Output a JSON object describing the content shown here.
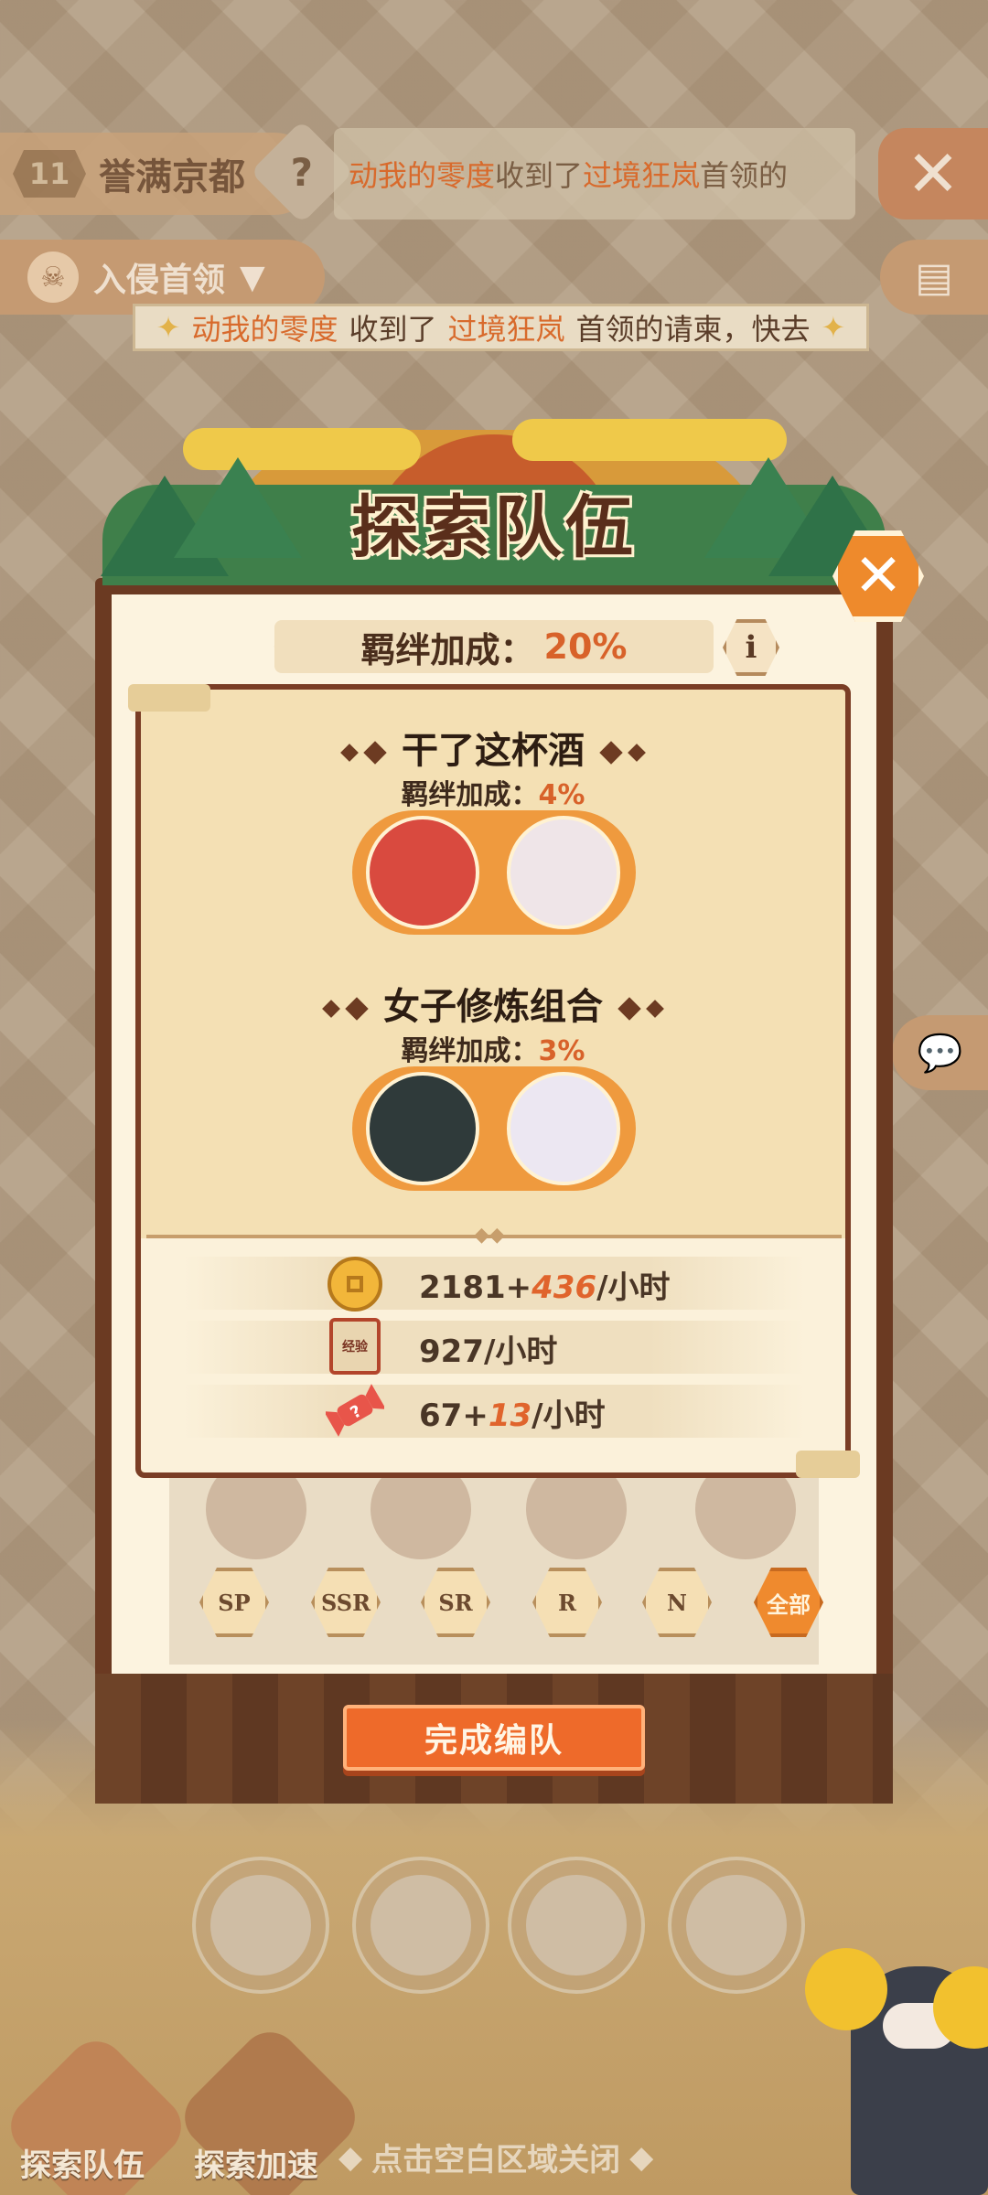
{
  "hud": {
    "level": "11",
    "region": "誉满京都",
    "help": "?",
    "ticker_a": "动我的零度",
    "ticker_b": "收到了",
    "ticker_c": "过境狂岚",
    "ticker_d": "首领的",
    "close": "✕",
    "boss_label": "入侵首领",
    "banner_a": "动我的零度",
    "banner_b": "收到了",
    "banner_c": "过境狂岚",
    "banner_d": "首领的请柬，快去"
  },
  "dialog": {
    "title": "探索队伍",
    "close": "✕",
    "bond_total_label": "羁绊加成：",
    "bond_total_value": "20%",
    "info": "i",
    "combos": [
      {
        "title": "干了这杯酒",
        "bond_label": "羁绊加成：",
        "bond_value": "4%"
      },
      {
        "title": "女子修炼组合",
        "bond_label": "羁绊加成：",
        "bond_value": "3%"
      }
    ],
    "yields": [
      {
        "icon": "coin-icon",
        "base": "2181",
        "plus": "+",
        "bonus": "436",
        "unit": "/小时"
      },
      {
        "icon": "exp-scroll-icon",
        "icon_text": "经验",
        "base": "927",
        "plus": "",
        "bonus": "",
        "unit": "/小时"
      },
      {
        "icon": "candy-icon",
        "base": "67",
        "plus": "+",
        "bonus": "13",
        "unit": "/小时"
      }
    ],
    "filters": [
      "SP",
      "SSR",
      "SR",
      "R",
      "N",
      "全部"
    ],
    "active_filter": "全部",
    "done_button": "完成编队"
  },
  "bottom": {
    "explore_team": "探索队伍",
    "explore_speed": "探索加速",
    "close_hint": "点击空白区域关闭"
  },
  "colors": {
    "accent": "#ee6a2a",
    "bond_pct": "#d8622a",
    "frame": "#7a3d25"
  }
}
